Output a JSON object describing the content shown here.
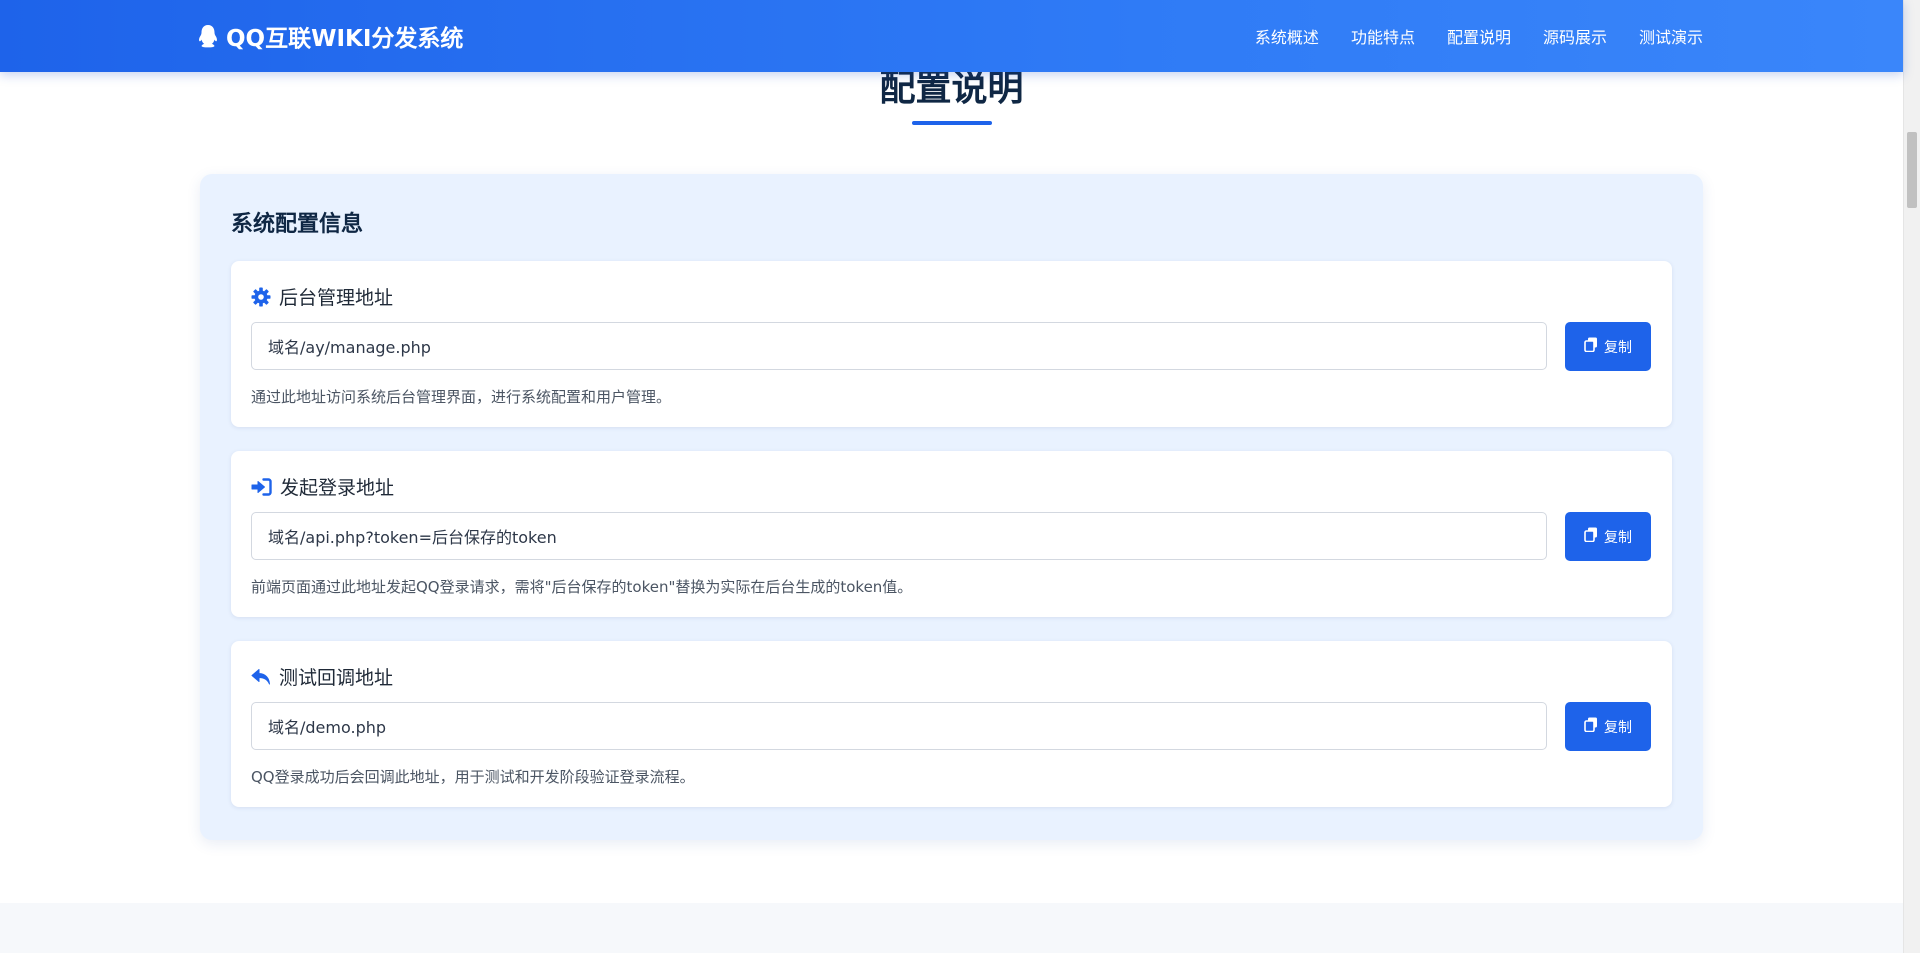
{
  "header": {
    "brand": "QQ互联WIKI分发系统",
    "brand_icon": "qq-penguin-icon",
    "nav": [
      "系统概述",
      "功能特点",
      "配置说明",
      "源码展示",
      "测试演示"
    ]
  },
  "section": {
    "title": "配置说明"
  },
  "panel": {
    "title": "系统配置信息",
    "cards": [
      {
        "icon": "gear-icon",
        "title": "后台管理地址",
        "value": "域名/ay/manage.php",
        "button": "复制",
        "description": "通过此地址访问系统后台管理界面，进行系统配置和用户管理。"
      },
      {
        "icon": "sign-in-icon",
        "title": "发起登录地址",
        "value": "域名/api.php?token=后台保存的token",
        "button": "复制",
        "description": "前端页面通过此地址发起QQ登录请求，需将\"后台保存的token\"替换为实际在后台生成的token值。"
      },
      {
        "icon": "reply-icon",
        "title": "测试回调地址",
        "value": "域名/demo.php",
        "button": "复制",
        "description": "QQ登录成功后会回调此地址，用于测试和开发阶段验证登录流程。"
      }
    ]
  },
  "colors": {
    "primary": "#1e63ea",
    "header_gradient_end": "#3a86fa",
    "panel_bg": "#e9f2ff",
    "heading": "#0f2744"
  }
}
